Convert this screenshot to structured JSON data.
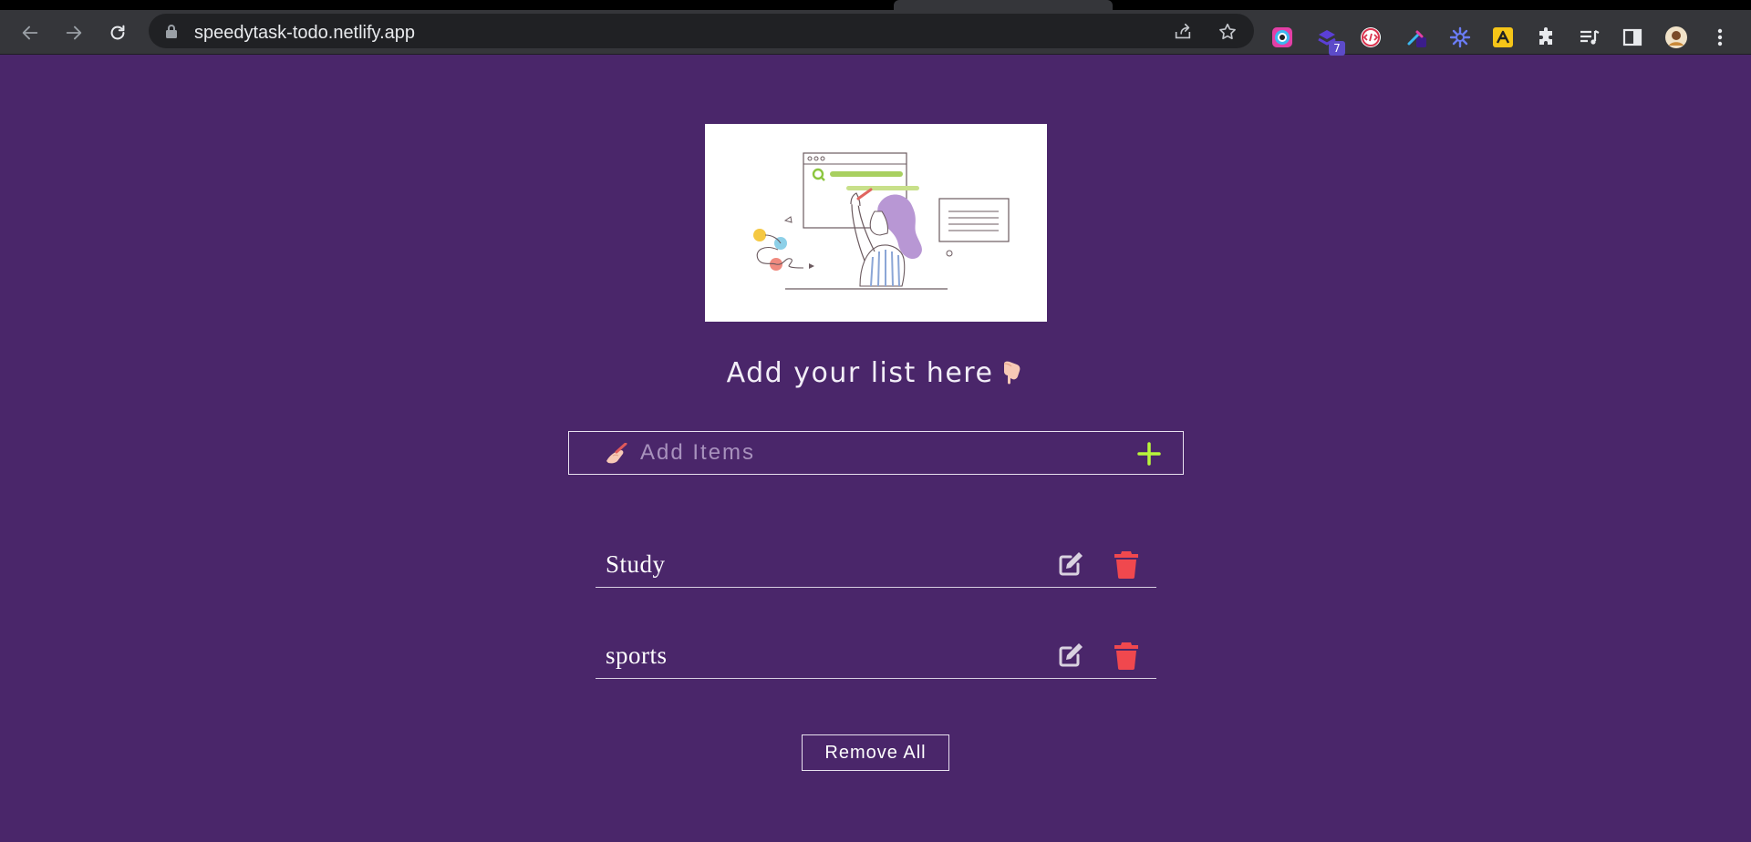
{
  "browser": {
    "url": "speedytask-todo.netlify.app",
    "extension_badge": "7"
  },
  "page": {
    "heading": "Add your list here",
    "add_input": {
      "placeholder": "Add Items",
      "value": ""
    },
    "items": [
      {
        "label": "Study"
      },
      {
        "label": "sports"
      }
    ],
    "remove_all_label": "Remove All"
  },
  "colors": {
    "background": "#4a266a",
    "accent_plus": "#b8f53b",
    "trash": "#f0484e",
    "edit": "#d9d2e0"
  }
}
